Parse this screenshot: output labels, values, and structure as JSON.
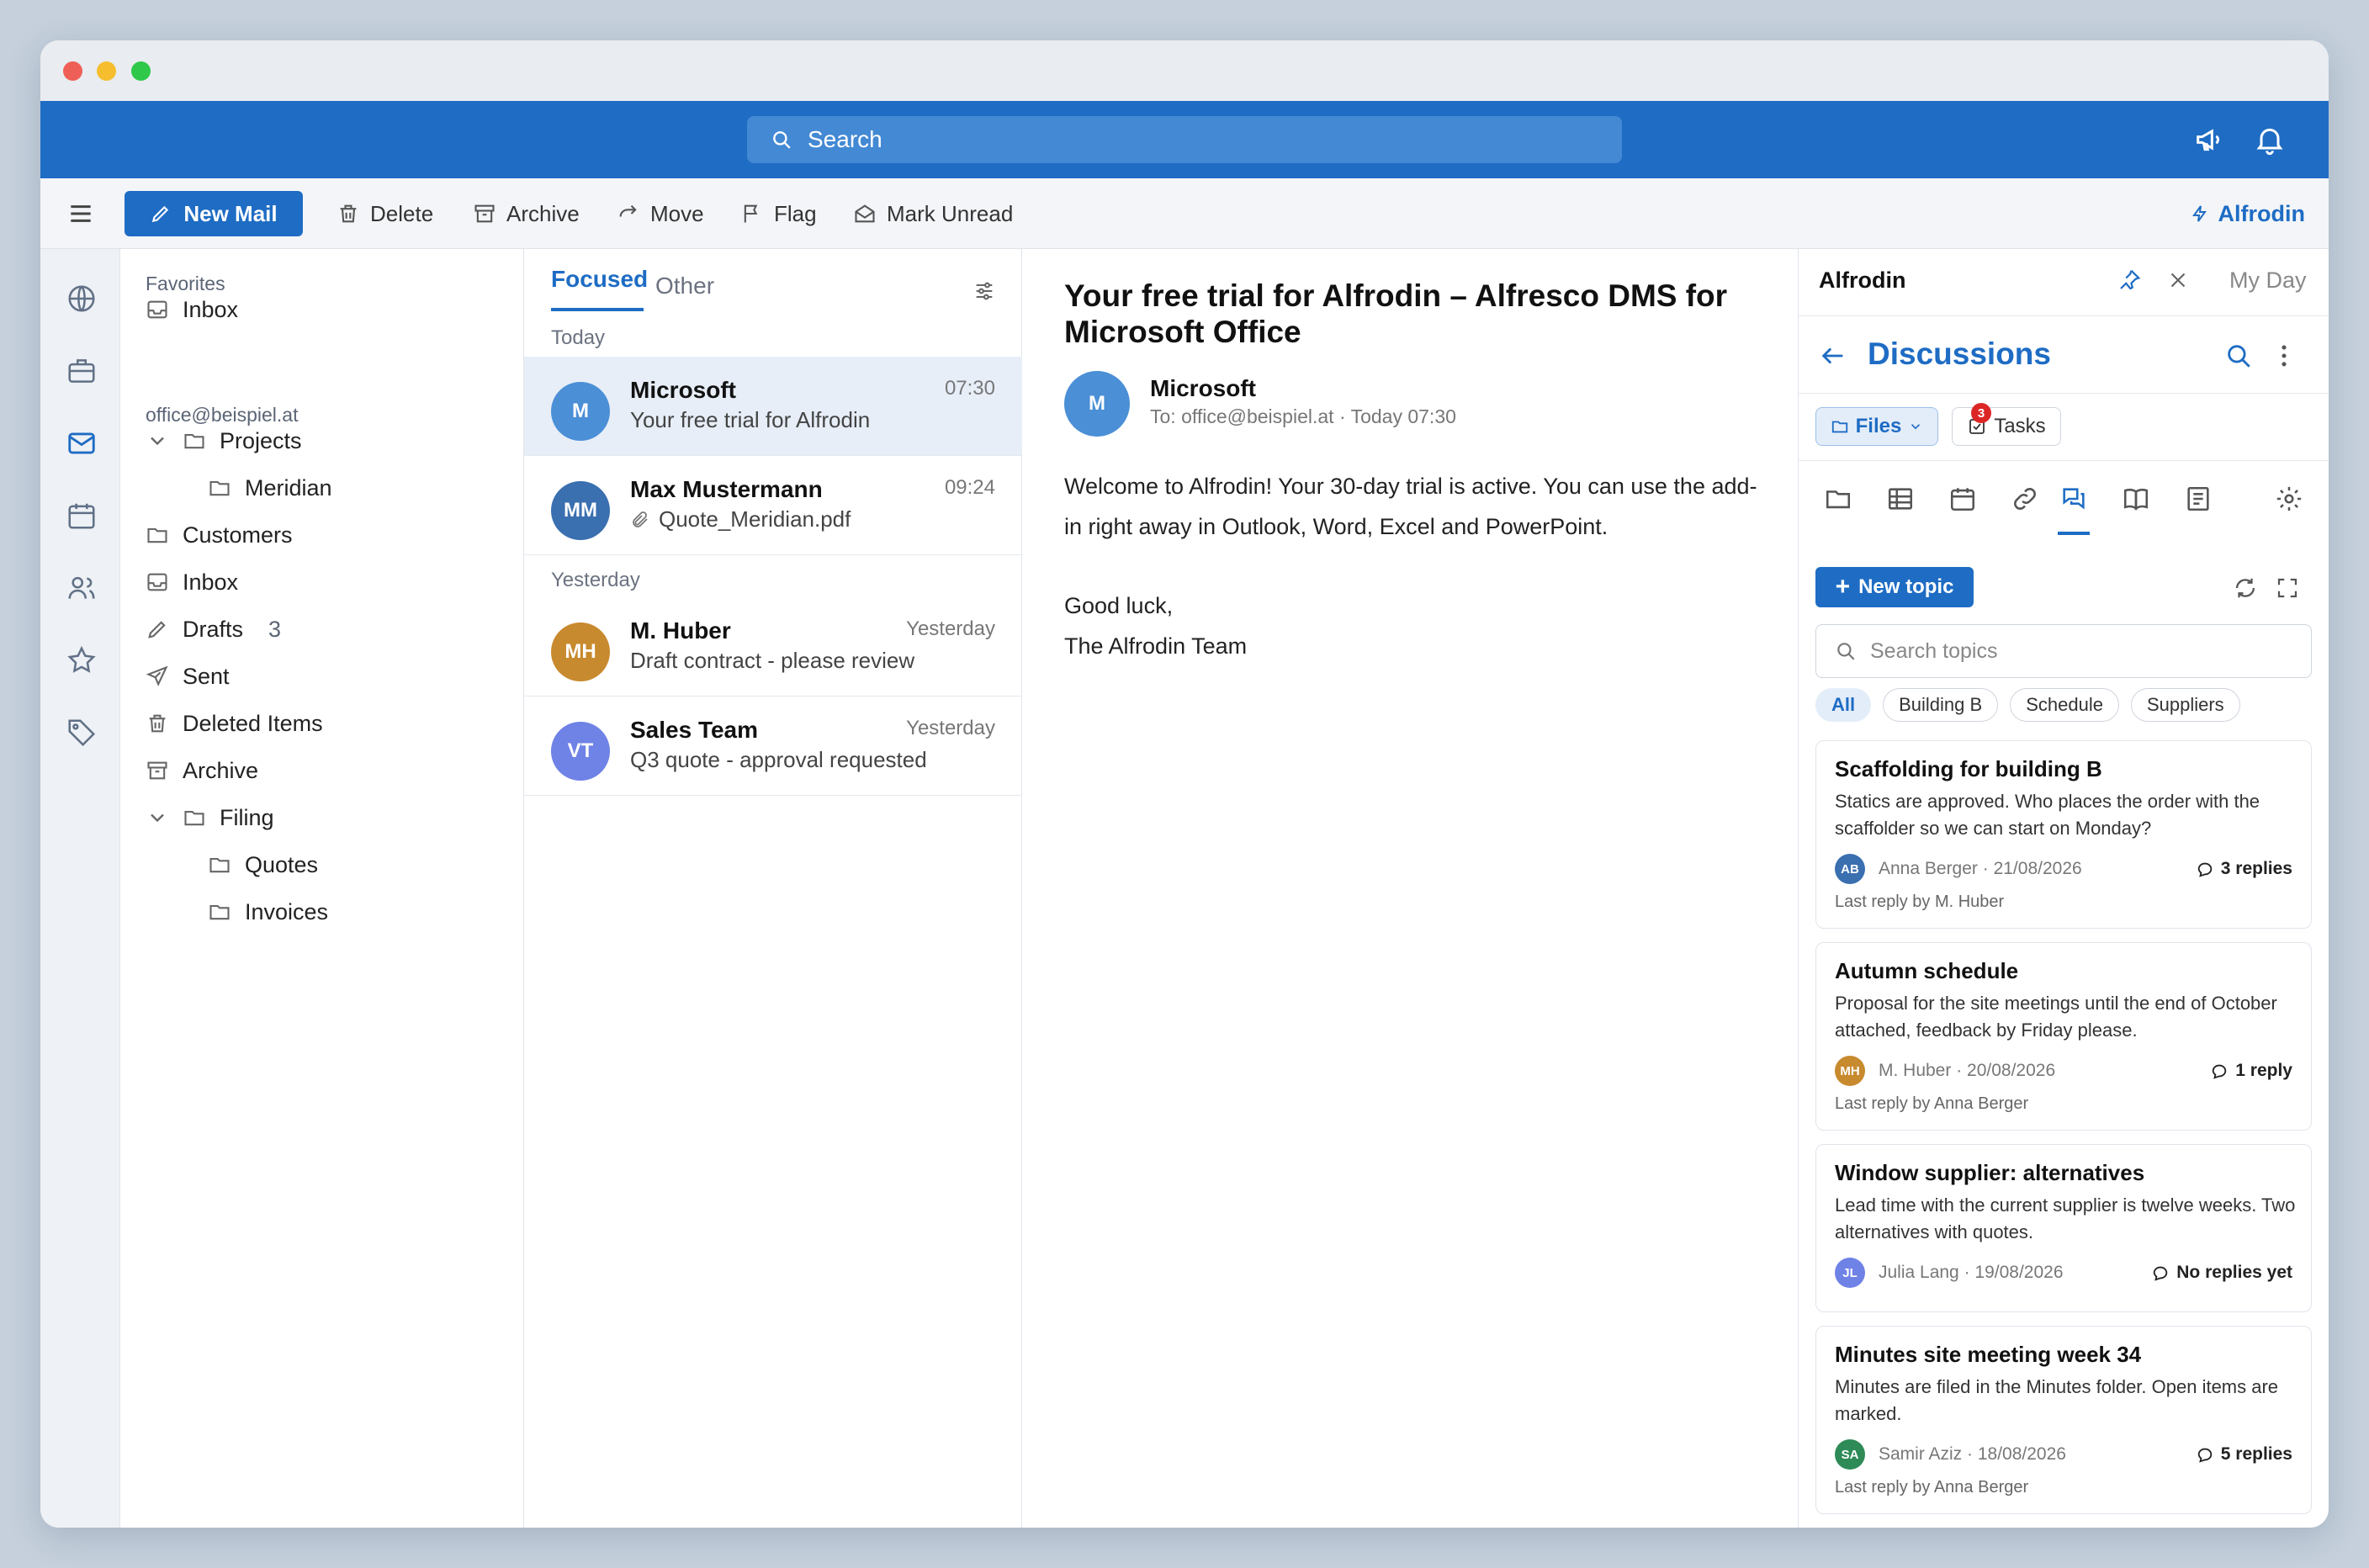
{
  "search": {
    "placeholder": "Search"
  },
  "toolbar": {
    "new_mail": "New Mail",
    "delete": "Delete",
    "archive": "Archive",
    "move": "Move",
    "flag": "Flag",
    "mark_unread": "Mark Unread",
    "addin": "Alfrodin"
  },
  "folders": {
    "favorites_label": "Favorites",
    "favorites_inbox": "Inbox",
    "account": "office@beispiel.at",
    "projects": "Projects",
    "meridian": "Meridian",
    "customers": "Customers",
    "inbox": "Inbox",
    "drafts": "Drafts",
    "drafts_count": "3",
    "sent": "Sent",
    "deleted": "Deleted Items",
    "archive": "Archive",
    "filing": "Filing",
    "quotes": "Quotes",
    "invoices": "Invoices"
  },
  "list": {
    "tab_focused": "Focused",
    "tab_other": "Other",
    "group_today": "Today",
    "group_yesterday": "Yesterday",
    "messages": [
      {
        "initials": "M",
        "color": "#4b8fd6",
        "from": "Microsoft",
        "subject": "Your free trial for Alfrodin",
        "time": "07:30"
      },
      {
        "initials": "MM",
        "color": "#3a6fb0",
        "from": "Max Mustermann",
        "subject": "Quote_Meridian.pdf",
        "time": "09:24"
      },
      {
        "initials": "MH",
        "color": "#c88a2e",
        "from": "M. Huber",
        "subject": "Draft contract - please review",
        "time": "Yesterday"
      },
      {
        "initials": "VT",
        "color": "#6f82e6",
        "from": "Sales Team",
        "subject": "Q3 quote - approval requested",
        "time": "Yesterday"
      }
    ]
  },
  "reading": {
    "title": "Your free trial for Alfrodin – Alfresco DMS for Microsoft Office",
    "avatar": "M",
    "from": "Microsoft",
    "to": "To: office@beispiel.at",
    "date": "Today 07:30",
    "body_1": "Welcome to Alfrodin! Your 30-day trial is active. You can use the add-in right away in Outlook, Word, Excel and PowerPoint.",
    "body_2": "Good luck,",
    "body_3": "The Alfrodin Team"
  },
  "side": {
    "brand": "Alfrodin",
    "my_day": "My Day",
    "title": "Discussions",
    "files": "Files",
    "tasks": "Tasks",
    "tasks_badge": "3",
    "new_topic": "New topic",
    "search_placeholder": "Search topics",
    "chips": [
      "All",
      "Building B",
      "Schedule",
      "Suppliers"
    ],
    "topics": [
      {
        "title": "Scaffolding for building B",
        "text": "Statics are approved. Who places the order with the scaffolder so we can start on Monday?",
        "initials": "AB",
        "color": "#3a6fb0",
        "author": "Anna Berger · 21/08/2026",
        "replies": "3 replies",
        "last": "Last reply by M. Huber"
      },
      {
        "title": "Autumn schedule",
        "text": "Proposal for the site meetings until the end of October attached, feedback by Friday please.",
        "initials": "MH",
        "color": "#c88a2e",
        "author": "M. Huber · 20/08/2026",
        "replies": "1 reply",
        "last": "Last reply by Anna Berger"
      },
      {
        "title": "Window supplier: alternatives",
        "text": "Lead time with the current supplier is twelve weeks. Two alternatives with quotes.",
        "initials": "JL",
        "color": "#6f82e6",
        "author": "Julia Lang · 19/08/2026",
        "replies": "No replies yet",
        "last": ""
      },
      {
        "title": "Minutes site meeting week 34",
        "text": "Minutes are filed in the Minutes folder. Open items are marked.",
        "initials": "SA",
        "color": "#2e8b57",
        "author": "Samir Aziz · 18/08/2026",
        "replies": "5 replies",
        "last": "Last reply by Anna Berger"
      }
    ]
  }
}
